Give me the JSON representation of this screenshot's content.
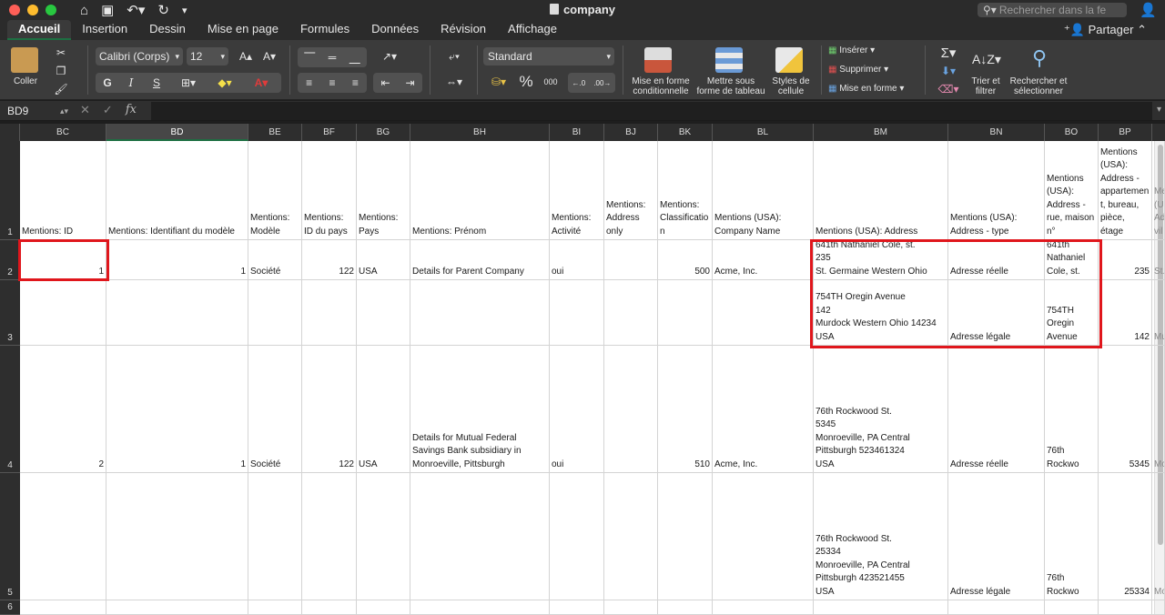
{
  "window": {
    "title": "company",
    "search_placeholder": "Rechercher dans la fe"
  },
  "ribbon_tabs": [
    "Accueil",
    "Insertion",
    "Dessin",
    "Mise en page",
    "Formules",
    "Données",
    "Révision",
    "Affichage"
  ],
  "share_label": "Partager",
  "ribbon": {
    "paste_label": "Coller",
    "font_name": "Calibri (Corps)",
    "font_size": "12",
    "bold": "G",
    "italic": "I",
    "underline": "S",
    "number_format": "Standard",
    "percent": "%",
    "thousands": "000",
    "cond_format_label": "Mise en forme\nconditionnelle",
    "table_format_label": "Mettre sous\nforme de tableau",
    "cell_styles_label": "Styles de\ncellule",
    "insert_label": "Insérer",
    "delete_label": "Supprimer",
    "format_label": "Mise en forme",
    "sort_filter_label": "Trier et\nfiltrer",
    "find_select_label": "Rechercher et\nsélectionner"
  },
  "formula_bar": {
    "name_box": "BD9",
    "fx_label": "fx",
    "formula": ""
  },
  "columns": [
    "BC",
    "BD",
    "BE",
    "BF",
    "BG",
    "BH",
    "BI",
    "BJ",
    "BK",
    "BL",
    "BM",
    "BN",
    "BO",
    "BP"
  ],
  "selected_column": "BD",
  "row_numbers": [
    "1",
    "2",
    "3",
    "4",
    "5",
    "6"
  ],
  "rows": [
    [
      "Mentions: ID",
      "Mentions: Identifiant du modèle",
      "Mentions:\nModèle",
      "Mentions:\nID du pays",
      "Mentions:\nPays",
      "Mentions: Prénom",
      "Mentions:\nActivité",
      "Mentions:\nAddress\nonly",
      "Mentions:\nClassificatio\nn",
      "Mentions (USA):\nCompany Name",
      "Mentions (USA): Address",
      "Mentions (USA):\nAddress - type",
      "Mentions\n(USA):\nAddress -\nrue, maison\nn°",
      "Mentions\n(USA):\nAddress -\nappartemen\nt, bureau,\npièce, étage"
    ],
    [
      "1",
      "1",
      "Société",
      "122",
      "USA",
      "Details for Parent Company",
      "oui",
      "",
      "500",
      "Acme, Inc.",
      "641th Nathaniel Cole, st.\n235\nSt. Germaine Western Ohio",
      "Adresse réelle",
      "641th\nNathaniel\nCole, st.",
      "235"
    ],
    [
      "",
      "",
      "",
      "",
      "",
      "",
      "",
      "",
      "",
      "",
      "754TH Oregin Avenue\n142\nMurdock Western Ohio 14234\nUSA",
      "Adresse légale",
      "754TH\nOregin\nAvenue",
      "142"
    ],
    [
      "2",
      "1",
      "Société",
      "122",
      "USA",
      "Details for Mutual Federal\nSavings Bank subsidiary in\nMonroeville, Pittsburgh",
      "oui",
      "",
      "510",
      "Acme, Inc.",
      "76th Rockwood St.\n5345\nMonroeville, PA Central\nPittsburgh 523461324\nUSA",
      "Adresse réelle",
      "76th Rockwo",
      "5345"
    ],
    [
      "",
      "",
      "",
      "",
      "",
      "",
      "",
      "",
      "",
      "",
      "76th Rockwood St.\n25334\nMonroeville, PA Central\nPittsburgh 423521455\nUSA",
      "Adresse légale",
      "76th Rockwo",
      "25334"
    ],
    [
      "",
      "",
      "",
      "",
      "",
      "",
      "",
      "",
      "",
      "",
      "",
      "",
      "",
      ""
    ]
  ],
  "overflow_column_text": [
    "Me\n(U\nAd\nvil",
    "St.",
    "Mu",
    "Mo",
    "Mo",
    ""
  ]
}
